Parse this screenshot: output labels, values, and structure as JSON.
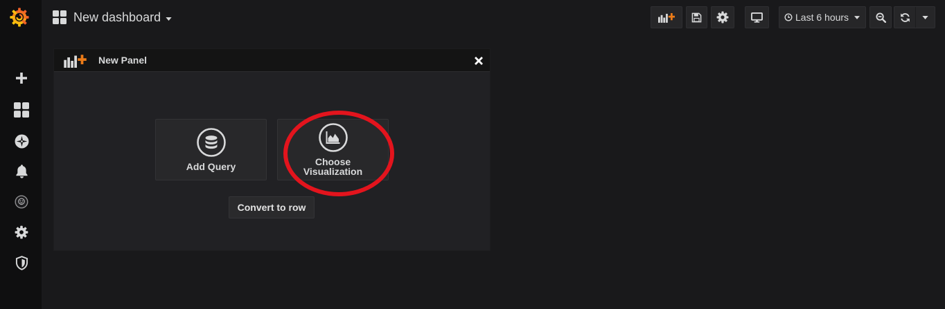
{
  "colors": {
    "brand_orange": "#f05a28",
    "brand_yellow": "#fbca0a",
    "add_accent": "#eb7b18",
    "annotation_red": "#e3141d",
    "text": "#d8d9da"
  },
  "sidebar": {
    "logo_icon": "grafana-logo-icon",
    "items": [
      {
        "icon": "plus-icon"
      },
      {
        "icon": "dashboards-grid-icon"
      },
      {
        "icon": "explore-compass-icon"
      },
      {
        "icon": "alert-bell-icon"
      },
      {
        "icon": "user-avatar-icon"
      },
      {
        "icon": "gear-icon"
      },
      {
        "icon": "shield-icon"
      }
    ]
  },
  "header": {
    "dashboard_icon": "dashboards-grid-icon",
    "title": "New dashboard",
    "title_caret_icon": "caret-down-icon",
    "toolbar": {
      "add_panel_icon": "add-panel-icon",
      "save_icon": "save-icon",
      "settings_icon": "gear-icon",
      "tv_mode_icon": "monitor-icon",
      "time_range": {
        "icon": "clock-icon",
        "label": "Last 6 hours",
        "caret_icon": "caret-down-icon"
      },
      "zoom_out_icon": "zoom-out-icon",
      "refresh_icon": "refresh-icon",
      "refresh_menu_icon": "caret-down-icon"
    }
  },
  "panel": {
    "header_icon": "add-panel-icon",
    "title": "New Panel",
    "close_icon": "close-icon",
    "actions": [
      {
        "icon": "database-icon",
        "label": "Add Query"
      },
      {
        "icon": "area-chart-icon",
        "label": "Choose Visualization"
      }
    ],
    "convert_label": "Convert to row"
  }
}
